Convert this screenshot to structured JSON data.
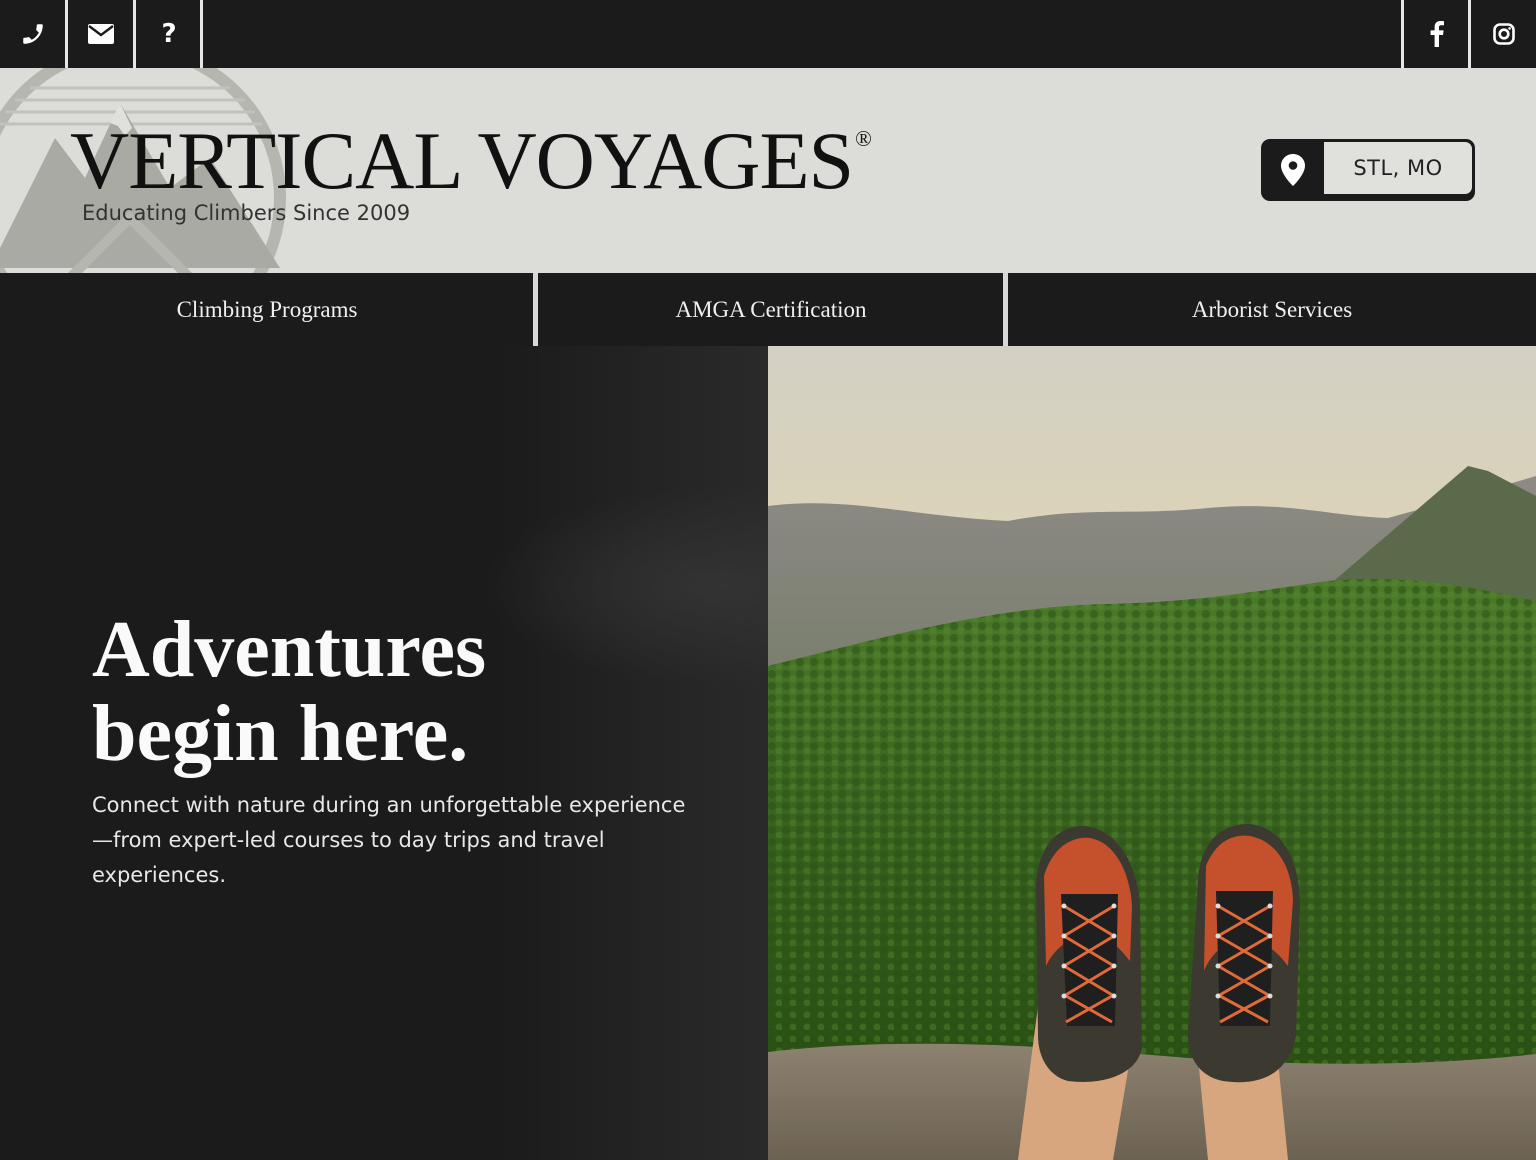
{
  "topbar": {
    "left_icons": [
      "phone-icon",
      "envelope-icon",
      "question-icon"
    ],
    "help_glyph": "?",
    "right_icons": [
      "facebook-icon",
      "instagram-icon"
    ]
  },
  "header": {
    "brand": "VERTICAL VOYAGES",
    "registered": "®",
    "tagline": "Educating Climbers Since 2009",
    "location": "STL, MO"
  },
  "nav": {
    "items": [
      {
        "label": "Climbing Programs"
      },
      {
        "label": "AMGA Certification"
      },
      {
        "label": "Arborist Services"
      }
    ]
  },
  "hero": {
    "headline_line1": "Adventures",
    "headline_line2": "begin here.",
    "body": "Connect with nature during an unforgettable experience—from expert-led courses to day trips and travel experiences."
  },
  "colors": {
    "dark": "#1b1b1b",
    "header_bg": "#dcdcd8",
    "accent_shoe": "#c4502c",
    "forest": "#3f6a22"
  }
}
